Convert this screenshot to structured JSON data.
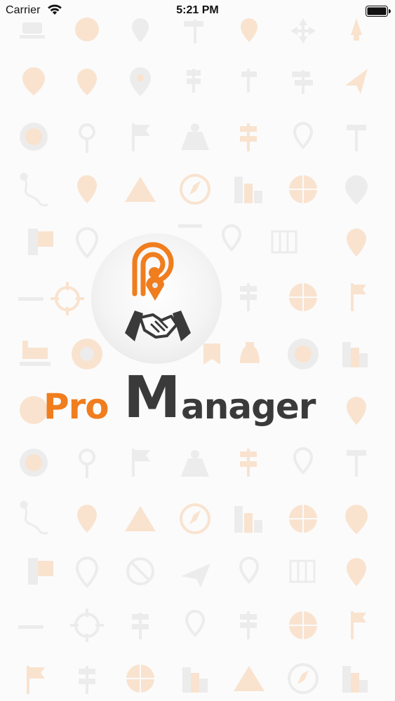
{
  "status_bar": {
    "carrier": "Carrier",
    "time": "5:21 PM",
    "wifi_icon": "wifi-icon",
    "battery_icon": "battery-icon"
  },
  "splash": {
    "brand_pro": "Pro",
    "brand_m": "M",
    "brand_rest": "anager",
    "logo_icon": "handshake-pin-logo",
    "background_icons": "map-navigation-icons"
  },
  "colors": {
    "orange": "#f07d1e",
    "dark_gray": "#3a3a3a",
    "pattern_orange": "#f9e3cf",
    "pattern_gray": "#ebebeb"
  }
}
